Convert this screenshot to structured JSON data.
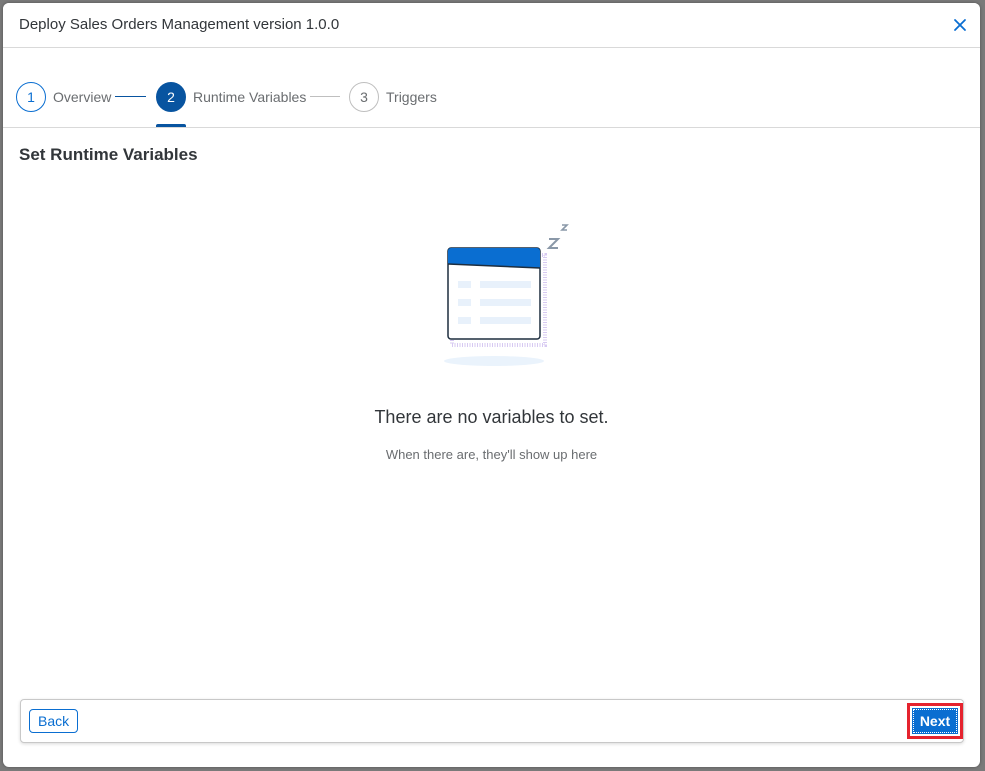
{
  "dialog": {
    "title": "Deploy Sales Orders Management version 1.0.0",
    "close_icon": "close-icon"
  },
  "wizard": {
    "steps": [
      {
        "number": "1",
        "label": "Overview",
        "state": "done"
      },
      {
        "number": "2",
        "label": "Runtime Variables",
        "state": "current"
      },
      {
        "number": "3",
        "label": "Triggers",
        "state": "future"
      }
    ]
  },
  "content": {
    "section_title": "Set Runtime Variables",
    "illustration_icon": "empty-sleeping-table-illustration",
    "empty_title": "There are no variables to set.",
    "empty_subtitle": "When there are, they'll show up here"
  },
  "footer": {
    "back_label": "Back",
    "next_label": "Next"
  },
  "colors": {
    "accent": "#0a6ed1",
    "current_step": "#0854a0",
    "highlight": "#e5232e"
  }
}
